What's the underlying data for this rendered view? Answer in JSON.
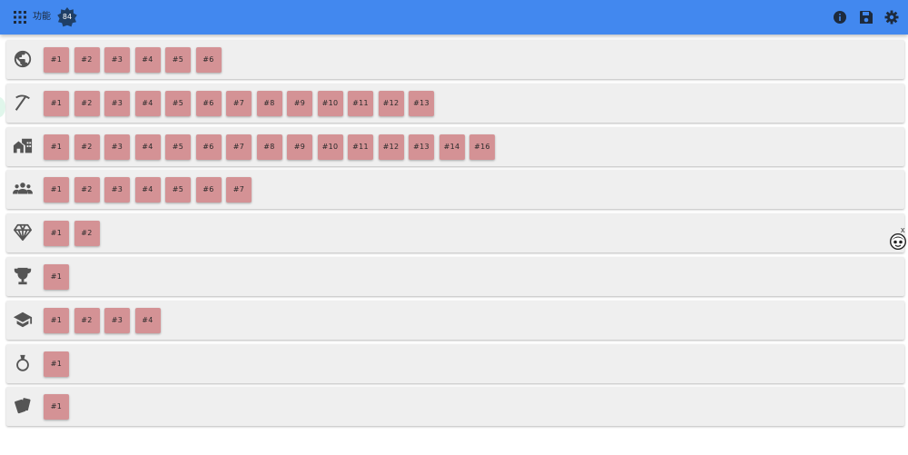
{
  "header": {
    "title": "功能",
    "badge_count": "84",
    "apps_icon": "apps-grid-icon",
    "actions": [
      {
        "name": "info",
        "icon": "info-icon"
      },
      {
        "name": "save",
        "icon": "save-icon"
      },
      {
        "name": "settings",
        "icon": "gear-icon"
      }
    ]
  },
  "colors": {
    "header_bg": "#4288ef",
    "row_bg": "#efefef",
    "chip_bg": "#d49295",
    "badge_bg": "#1f3f66"
  },
  "rows": [
    {
      "key": "globe",
      "icon": "globe-icon",
      "items": [
        "#1",
        "#2",
        "#3",
        "#4",
        "#5",
        "#6"
      ]
    },
    {
      "key": "pickaxe",
      "icon": "pickaxe-icon",
      "items": [
        "#1",
        "#2",
        "#3",
        "#4",
        "#5",
        "#6",
        "#7",
        "#8",
        "#9",
        "#10",
        "#11",
        "#12",
        "#13"
      ]
    },
    {
      "key": "home",
      "icon": "home-work-icon",
      "items": [
        "#1",
        "#2",
        "#3",
        "#4",
        "#5",
        "#6",
        "#7",
        "#8",
        "#9",
        "#10",
        "#11",
        "#12",
        "#13",
        "#14",
        "#16"
      ]
    },
    {
      "key": "people",
      "icon": "people-group-icon",
      "items": [
        "#1",
        "#2",
        "#3",
        "#4",
        "#5",
        "#6",
        "#7"
      ]
    },
    {
      "key": "diamond",
      "icon": "diamond-icon",
      "items": [
        "#1",
        "#2"
      ]
    },
    {
      "key": "trophy",
      "icon": "trophy-icon",
      "items": [
        "#1"
      ]
    },
    {
      "key": "school",
      "icon": "graduation-cap-icon",
      "items": [
        "#1",
        "#2",
        "#3",
        "#4"
      ]
    },
    {
      "key": "ring",
      "icon": "ring-icon",
      "items": [
        "#1"
      ]
    },
    {
      "key": "cards",
      "icon": "cards-icon",
      "items": [
        "#1"
      ]
    }
  ],
  "floating": {
    "close_label": "x",
    "icon": "mascot-face-icon"
  }
}
